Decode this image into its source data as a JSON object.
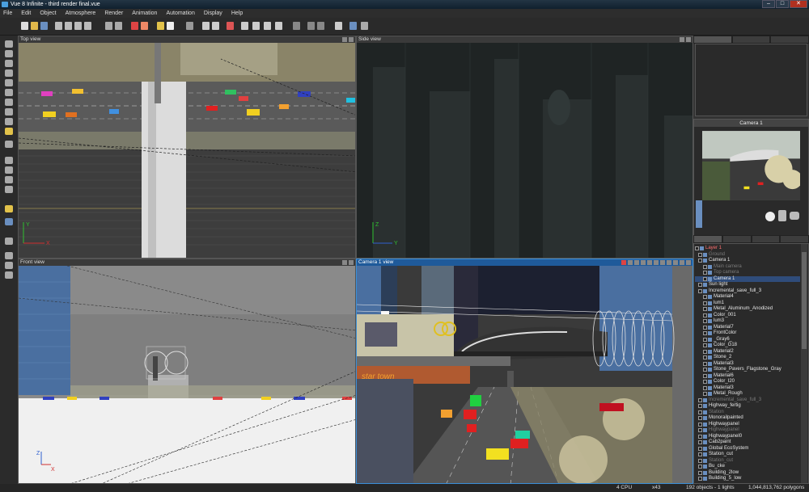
{
  "window": {
    "title": "Vue 8 Infinite - third render final.vue",
    "min": "–",
    "max": "□",
    "close": "✕"
  },
  "menu": [
    "File",
    "Edit",
    "Object",
    "Atmosphere",
    "Render",
    "Animation",
    "Automation",
    "Display",
    "Help"
  ],
  "viewports": {
    "top": {
      "label": "Top view",
      "axis_y": "Y",
      "axis_x": "X"
    },
    "side": {
      "label": "Side view",
      "axis_y": "Z",
      "axis_x": "Y"
    },
    "front": {
      "label": "Front view",
      "axis_y": "Z",
      "axis_x": "X"
    },
    "camera": {
      "label": "Camera 1 view",
      "billboard": "star town"
    }
  },
  "camera_preview": {
    "title": "Camera 1"
  },
  "world_browser": [
    {
      "label": "Layer 1",
      "state": "sel"
    },
    {
      "label": "Ground",
      "state": "dim"
    },
    {
      "label": "Camera 1",
      "state": ""
    },
    {
      "label": "Main camera",
      "state": "dim"
    },
    {
      "label": "Top camera",
      "state": "dim"
    },
    {
      "label": "Camera 1",
      "state": "hl"
    },
    {
      "label": "Sun light",
      "state": ""
    },
    {
      "label": "Incremental_save_full_3",
      "state": ""
    },
    {
      "label": "Material4",
      "state": ""
    },
    {
      "label": "lum1",
      "state": ""
    },
    {
      "label": "Metal_Aluminum_Anodized",
      "state": ""
    },
    {
      "label": "Color_001",
      "state": ""
    },
    {
      "label": "lum3",
      "state": ""
    },
    {
      "label": "Material7",
      "state": ""
    },
    {
      "label": "FrontColor",
      "state": ""
    },
    {
      "label": "_Gray6_",
      "state": ""
    },
    {
      "label": "Color_G18",
      "state": ""
    },
    {
      "label": "Material2",
      "state": ""
    },
    {
      "label": "Stone_2",
      "state": ""
    },
    {
      "label": "Material3",
      "state": ""
    },
    {
      "label": "Stone_Pavers_Flagstone_Gray",
      "state": ""
    },
    {
      "label": "Material6",
      "state": ""
    },
    {
      "label": "Color_I20",
      "state": ""
    },
    {
      "label": "Material3",
      "state": ""
    },
    {
      "label": "Metal_Rough",
      "state": ""
    },
    {
      "label": "Incremental_save_full_3",
      "state": "dim"
    },
    {
      "label": "Highway_fertig",
      "state": ""
    },
    {
      "label": "Station",
      "state": "dim"
    },
    {
      "label": "Monorailpainted",
      "state": ""
    },
    {
      "label": "Highwaypanel",
      "state": ""
    },
    {
      "label": "Highwaypanel",
      "state": "dim"
    },
    {
      "label": "Highwaypanel0",
      "state": ""
    },
    {
      "label": "Cab2paint",
      "state": ""
    },
    {
      "label": "Global EcoSystem",
      "state": ""
    },
    {
      "label": "Station_cut",
      "state": ""
    },
    {
      "label": "Station_cut",
      "state": "dim"
    },
    {
      "label": "Bu_cke",
      "state": ""
    },
    {
      "label": "Building_2low",
      "state": ""
    },
    {
      "label": "Building_5_low",
      "state": ""
    }
  ],
  "status": {
    "cpu": "4 CPU",
    "zoom": "x43",
    "objects": "192 objects - 1 lights",
    "polygons": "1,044,813,762 polygons"
  },
  "colors": {
    "accent": "#3b8fd8",
    "selected_layer": "#ff7070",
    "camera_header": "#1f5a9a"
  }
}
